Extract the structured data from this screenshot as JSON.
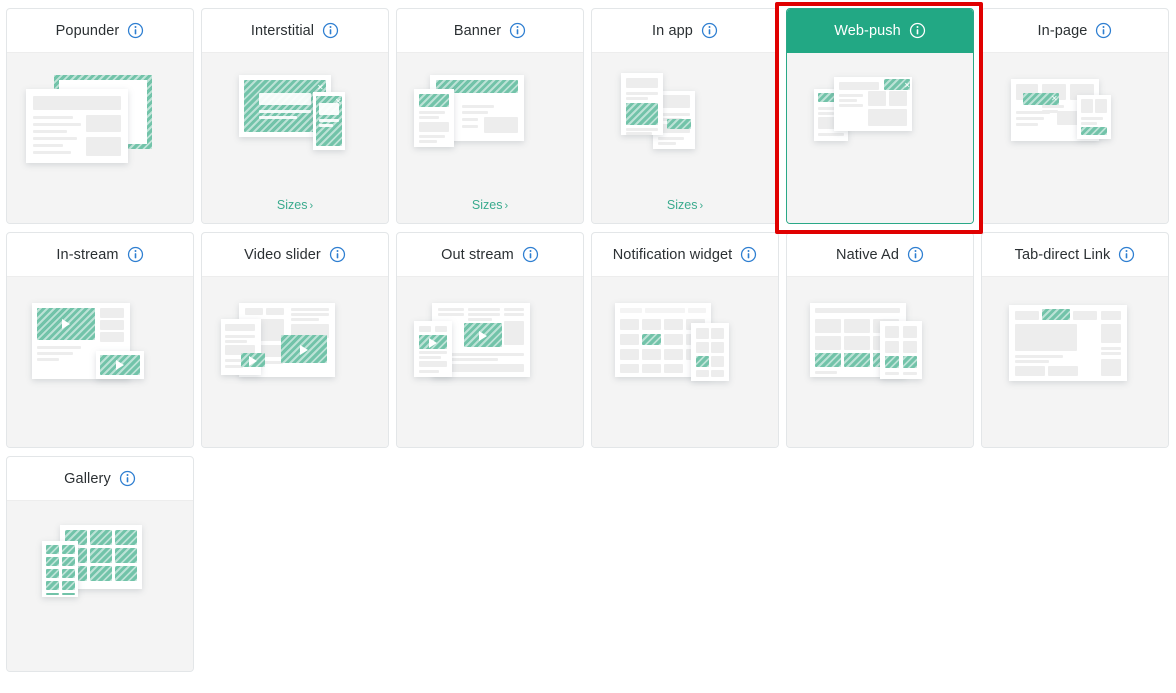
{
  "theme": {
    "accent_teal": "#22a884",
    "thumb_teal": "#72c3a9",
    "link_teal": "#3aab8e",
    "info_blue": "#2f7fd1",
    "highlight_red": "#e00000",
    "card_bg": "#f4f4f4",
    "header_bg": "#ffffff",
    "title_color": "#2b3033"
  },
  "icons": {
    "info": "info-icon",
    "chevron_right": "chevron-right-icon",
    "close": "close-icon",
    "play": "play-icon"
  },
  "labels": {
    "sizes": "Sizes",
    "chevron": "›"
  },
  "formats": [
    {
      "id": "popunder",
      "label": "Popunder",
      "info": true,
      "sizes": false,
      "selected": false
    },
    {
      "id": "interstitial",
      "label": "Interstitial",
      "info": true,
      "sizes": true,
      "selected": false
    },
    {
      "id": "banner",
      "label": "Banner",
      "info": true,
      "sizes": true,
      "selected": false
    },
    {
      "id": "in-app",
      "label": "In app",
      "info": true,
      "sizes": true,
      "selected": false
    },
    {
      "id": "web-push",
      "label": "Web-push",
      "info": true,
      "sizes": false,
      "selected": true
    },
    {
      "id": "in-page",
      "label": "In-page",
      "info": true,
      "sizes": false,
      "selected": false
    },
    {
      "id": "in-stream",
      "label": "In-stream",
      "info": true,
      "sizes": false,
      "selected": false
    },
    {
      "id": "video-slider",
      "label": "Video slider",
      "info": true,
      "sizes": false,
      "selected": false
    },
    {
      "id": "out-stream",
      "label": "Out stream",
      "info": true,
      "sizes": false,
      "selected": false
    },
    {
      "id": "notification-widget",
      "label": "Notification widget",
      "info": true,
      "sizes": false,
      "selected": false
    },
    {
      "id": "native-ad",
      "label": "Native Ad",
      "info": true,
      "sizes": false,
      "selected": false
    },
    {
      "id": "tab-direct-link",
      "label": "Tab-direct Link",
      "info": true,
      "sizes": false,
      "selected": false
    },
    {
      "id": "gallery",
      "label": "Gallery",
      "info": true,
      "sizes": false,
      "selected": false
    }
  ],
  "selection": {
    "selected_format_id": "web-push",
    "selected_format_label": "Web-push",
    "highlight_style": "red-rectangle"
  }
}
